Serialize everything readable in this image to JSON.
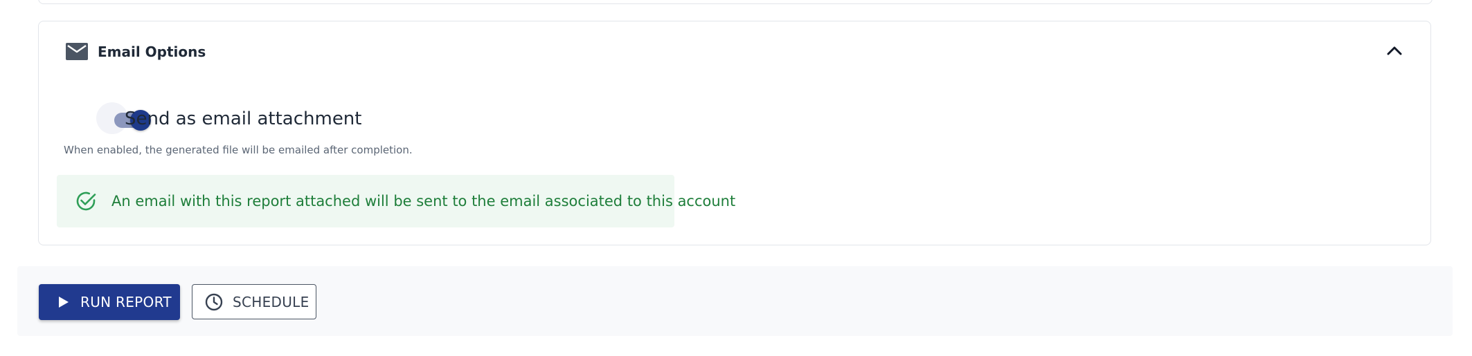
{
  "email_options": {
    "title": "Email Options",
    "icon": "mail-icon",
    "collapse_icon": "chevron-up-icon",
    "toggle": {
      "label": "Send as email attachment",
      "checked": true,
      "helper_text": "When enabled, the generated file will be emailed after completion."
    },
    "alert": {
      "icon": "check-circle-icon",
      "text": "An email with this report attached will be sent to the email associated to this account"
    }
  },
  "actions": {
    "run_label": "RUN REPORT",
    "run_icon": "play-icon",
    "schedule_label": "SCHEDULE",
    "schedule_icon": "clock-icon"
  },
  "colors": {
    "primary": "#213a8f",
    "success_text": "#1e7e3a",
    "success_bg": "#eff8f2",
    "toggle_track": "#8c97bd"
  }
}
